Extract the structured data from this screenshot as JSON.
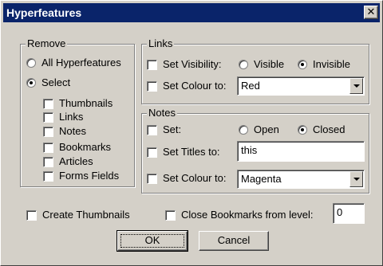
{
  "window": {
    "title": "Hyperfeatures",
    "close_glyph": "✕"
  },
  "remove": {
    "legend": "Remove",
    "all_label": "All Hyperfeatures",
    "select_label": "Select",
    "items": [
      "Thumbnails",
      "Links",
      "Notes",
      "Bookmarks",
      "Articles",
      "Forms Fields"
    ]
  },
  "links": {
    "legend": "Links",
    "set_visibility_label": "Set Visibility:",
    "visible_label": "Visible",
    "invisible_label": "Invisible",
    "selected_visibility": "Invisible",
    "set_colour_label": "Set Colour to:",
    "colour_value": "Red"
  },
  "notes": {
    "legend": "Notes",
    "set_label": "Set:",
    "open_label": "Open",
    "closed_label": "Closed",
    "selected_state": "Closed",
    "set_titles_label": "Set Titles to:",
    "titles_value": "this",
    "set_colour_label": "Set Colour to:",
    "colour_value": "Magenta"
  },
  "bottom": {
    "create_thumbnails_label": "Create Thumbnails",
    "close_bookmarks_label": "Close Bookmarks from level:",
    "level_value": "0"
  },
  "buttons": {
    "ok": "OK",
    "cancel": "Cancel"
  }
}
